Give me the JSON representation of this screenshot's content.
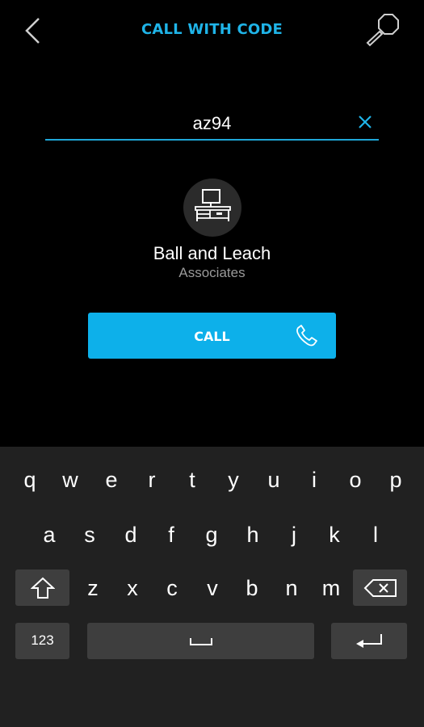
{
  "header": {
    "title": "CALL WITH CODE",
    "back_icon": "chevron-left-icon",
    "search_icon": "magnifier-icon"
  },
  "code_field": {
    "value": "az94",
    "clear_icon": "close-icon"
  },
  "contact": {
    "avatar_icon": "office-desk-icon",
    "name": "Ball and Leach",
    "subtitle": "Associates"
  },
  "call_button": {
    "label": "CALL",
    "icon": "phone-icon"
  },
  "keyboard": {
    "row1": [
      "q",
      "w",
      "e",
      "r",
      "t",
      "y",
      "u",
      "i",
      "o",
      "p"
    ],
    "row2": [
      "a",
      "s",
      "d",
      "f",
      "g",
      "h",
      "j",
      "k",
      "l"
    ],
    "row3": [
      "z",
      "x",
      "c",
      "v",
      "b",
      "n",
      "m"
    ],
    "numbers_label": "123",
    "shift_icon": "shift-arrow-icon",
    "backspace_icon": "backspace-icon",
    "space_icon": "space-bar-icon",
    "return_icon": "return-arrow-icon"
  },
  "colors": {
    "accent": "#1fb4e8",
    "call_button": "#0db0ea",
    "background": "#000000",
    "keyboard_bg": "#212121",
    "function_key_bg": "#3e3e3e"
  }
}
